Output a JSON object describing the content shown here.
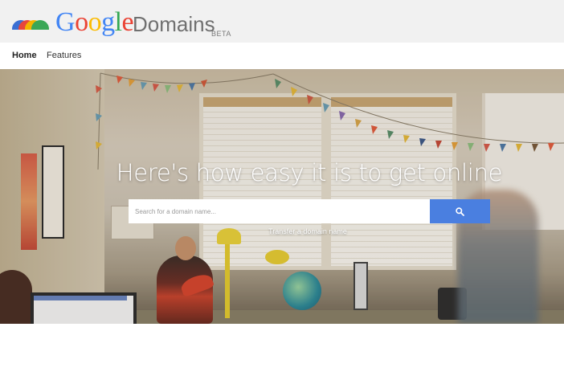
{
  "brand": {
    "google_letters": [
      {
        "char": "G",
        "color": "#4285f4"
      },
      {
        "char": "o",
        "color": "#ea4335"
      },
      {
        "char": "o",
        "color": "#fbbc05"
      },
      {
        "char": "g",
        "color": "#4285f4"
      },
      {
        "char": "l",
        "color": "#34a853"
      },
      {
        "char": "e",
        "color": "#ea4335"
      }
    ],
    "google": "Google",
    "product": "Domains",
    "badge": "BETA",
    "logo_colors": [
      "#3b6fd3",
      "#e8463b",
      "#f4b400",
      "#3aa757"
    ]
  },
  "nav": {
    "home": "Home",
    "features": "Features"
  },
  "hero": {
    "title": "Here's how easy it is to get online",
    "search_placeholder": "Search for a domain name...",
    "search_icon": "search-icon",
    "transfer_link": "Transfer a domain name",
    "accent_color": "#4a7fe0"
  }
}
